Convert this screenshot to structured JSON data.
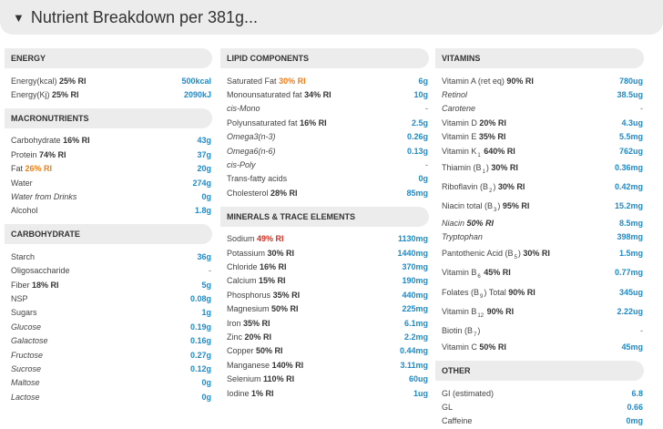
{
  "header": {
    "arrow": "▼",
    "title": "Nutrient Breakdown per 381g..."
  },
  "colors": {
    "value": "#1f8ac9",
    "orange_ri": "#f07d14",
    "red_ri": "#d42c1e",
    "panel": "#ececec"
  },
  "sections": {
    "energy": {
      "title": "ENERGY",
      "rows": [
        {
          "name": "Energy(kcal)",
          "ri": "25% RI",
          "value": "500kcal"
        },
        {
          "name": "Energy(Kj)",
          "ri": "25% RI",
          "value": "2090kJ"
        }
      ]
    },
    "macronutrients": {
      "title": "MACRONUTRIENTS",
      "rows": [
        {
          "name": "Carbohydrate",
          "ri": "16% RI",
          "value": "43g"
        },
        {
          "name": "Protein",
          "ri": "74% RI",
          "value": "37g"
        },
        {
          "name": "Fat",
          "ri": "26% RI",
          "value": "20g"
        },
        {
          "name": "Water",
          "ri": "",
          "value": "274g"
        },
        {
          "name": "Water from Drinks",
          "ri": "",
          "value": "0g"
        },
        {
          "name": "Alcohol",
          "ri": "",
          "value": "1.8g"
        }
      ]
    },
    "carbohydrate": {
      "title": "CARBOHYDRATE",
      "rows": [
        {
          "name": "Starch",
          "ri": "",
          "value": "36g"
        },
        {
          "name": "Oligosaccharide",
          "ri": "",
          "value": "-"
        },
        {
          "name": "Fiber",
          "ri": "18% RI",
          "value": "5g"
        },
        {
          "name": "NSP",
          "ri": "",
          "value": "0.08g"
        },
        {
          "name": "Sugars",
          "ri": "",
          "value": "1g"
        },
        {
          "name": "Glucose",
          "ri": "",
          "value": "0.19g"
        },
        {
          "name": "Galactose",
          "ri": "",
          "value": "0.16g"
        },
        {
          "name": "Fructose",
          "ri": "",
          "value": "0.27g"
        },
        {
          "name": "Sucrose",
          "ri": "",
          "value": "0.12g"
        },
        {
          "name": "Maltose",
          "ri": "",
          "value": "0g"
        },
        {
          "name": "Lactose",
          "ri": "",
          "value": "0g"
        }
      ]
    },
    "lipid": {
      "title": "LIPID COMPONENTS",
      "rows": [
        {
          "name": "Saturated Fat",
          "ri": "30% RI",
          "value": "6g"
        },
        {
          "name": "Monounsaturated fat",
          "ri": "34% RI",
          "value": "10g"
        },
        {
          "name": "cis-Mono",
          "ri": "",
          "value": "-"
        },
        {
          "name": "Polyunsaturated fat",
          "ri": "16% RI",
          "value": "2.5g"
        },
        {
          "name": "Omega3(n-3)",
          "ri": "",
          "value": "0.26g"
        },
        {
          "name": "Omega6(n-6)",
          "ri": "",
          "value": "0.13g"
        },
        {
          "name": "cis-Poly",
          "ri": "",
          "value": "-"
        },
        {
          "name": "Trans-fatty acids",
          "ri": "",
          "value": "0g"
        },
        {
          "name": "Cholesterol",
          "ri": "28% RI",
          "value": "85mg"
        }
      ]
    },
    "minerals": {
      "title": "MINERALS & TRACE ELEMENTS",
      "rows": [
        {
          "name": "Sodium",
          "ri": "49% RI",
          "value": "1130mg"
        },
        {
          "name": "Potassium",
          "ri": "30% RI",
          "value": "1440mg"
        },
        {
          "name": "Chloride",
          "ri": "16% RI",
          "value": "370mg"
        },
        {
          "name": "Calcium",
          "ri": "15% RI",
          "value": "190mg"
        },
        {
          "name": "Phosphorus",
          "ri": "35% RI",
          "value": "440mg"
        },
        {
          "name": "Magnesium",
          "ri": "50% RI",
          "value": "225mg"
        },
        {
          "name": "Iron",
          "ri": "35% RI",
          "value": "6.1mg"
        },
        {
          "name": "Zinc",
          "ri": "20% RI",
          "value": "2.2mg"
        },
        {
          "name": "Copper",
          "ri": "50% RI",
          "value": "0.44mg"
        },
        {
          "name": "Manganese",
          "ri": "140% RI",
          "value": "3.11mg"
        },
        {
          "name": "Selenium",
          "ri": "110% RI",
          "value": "60ug"
        },
        {
          "name": "Iodine",
          "ri": "1% RI",
          "value": "1ug"
        }
      ]
    },
    "vitamins": {
      "title": "VITAMINS",
      "rows": [
        {
          "name": "Vitamin A (ret eq)",
          "ri": "90% RI",
          "value": "780ug"
        },
        {
          "name": "Retinol",
          "ri": "",
          "value": "38.5ug"
        },
        {
          "name": "Carotene",
          "ri": "",
          "value": "-"
        },
        {
          "name": "Vitamin D",
          "ri": "20% RI",
          "value": "4.3ug"
        },
        {
          "name": "Vitamin E",
          "ri": "35% RI",
          "value": "5.5mg"
        },
        {
          "name": "Vitamin K",
          "sub": "1",
          "ri": "640% RI",
          "value": "762ug"
        },
        {
          "name": "Thiamin (B",
          "sub": "1",
          "suffix": ")",
          "ri": "30% RI",
          "value": "0.36mg"
        },
        {
          "name": "Riboflavin (B",
          "sub": "2",
          "suffix": ")",
          "ri": "30% RI",
          "value": "0.42mg"
        },
        {
          "name": "Niacin total (B",
          "sub": "3",
          "suffix": ")",
          "ri": "95% RI",
          "value": "15.2mg"
        },
        {
          "name": "Niacin",
          "ri": "50% RI",
          "value": "8.5mg"
        },
        {
          "name": "Tryptophan",
          "ri": "",
          "value": "398mg"
        },
        {
          "name": "Pantothenic Acid (B",
          "sub": "5",
          "suffix": ")",
          "ri": "30% RI",
          "value": "1.5mg"
        },
        {
          "name": "Vitamin B",
          "sub": "6",
          "ri": "45% RI",
          "value": "0.77mg"
        },
        {
          "name": "Folates (B",
          "sub": "9",
          "suffix": ") Total",
          "ri": "90% RI",
          "value": "345ug"
        },
        {
          "name": "Vitamin B",
          "sub": "12",
          "ri": "90% RI",
          "value": "2.22ug"
        },
        {
          "name": "Biotin (B",
          "sub": "7",
          "suffix": ")",
          "ri": "",
          "value": "-"
        },
        {
          "name": "Vitamin C",
          "ri": "50% RI",
          "value": "45mg"
        }
      ]
    },
    "other": {
      "title": "OTHER",
      "rows": [
        {
          "name": "GI (estimated)",
          "ri": "",
          "value": "6.8"
        },
        {
          "name": "GL",
          "ri": "",
          "value": "0.66"
        },
        {
          "name": "Caffeine",
          "ri": "",
          "value": "0mg"
        }
      ]
    }
  }
}
